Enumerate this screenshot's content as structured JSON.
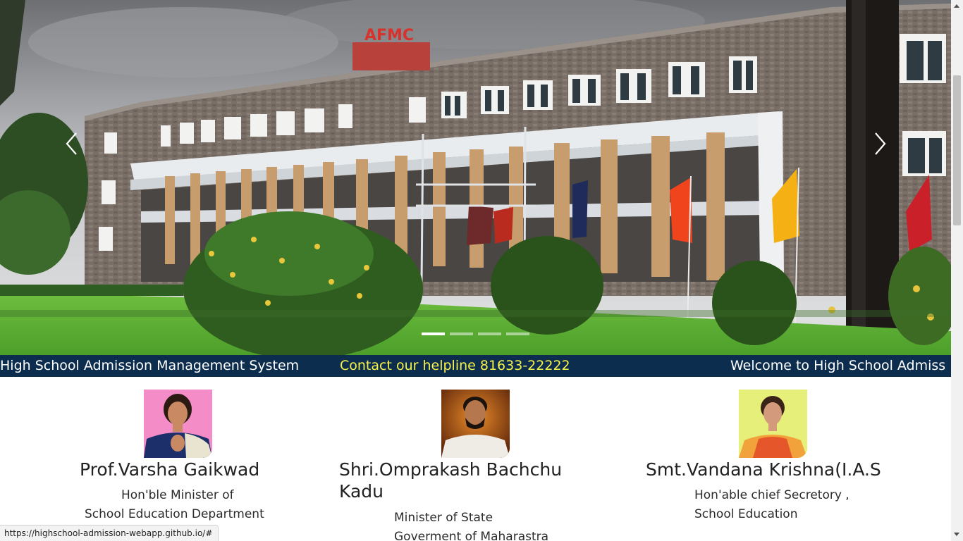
{
  "carousel": {
    "prev_label": "‹",
    "next_label": "›",
    "building_sign": "AFMC",
    "slides_count_label": "",
    "indicators": [
      {
        "active": true
      },
      {
        "active": false
      },
      {
        "active": false
      },
      {
        "active": false
      }
    ]
  },
  "marquee": {
    "items": [
      "High School Admission Management System",
      "Contact our helpline 81633-22222",
      "Welcome to High School Admiss"
    ],
    "highlight_color": "#f7f24a",
    "background_color": "#0d2d4e"
  },
  "officials": [
    {
      "name": "Prof.Varsha Gaikwad",
      "lines": [
        "Hon'ble Minister of",
        "School Education Department"
      ],
      "photo_background": "#f48cc8"
    },
    {
      "name_line1": "Shri.Omprakash Bachchu",
      "name_line2": "Kadu",
      "lines": [
        "Minister of State",
        "Goverment of Maharastra"
      ],
      "photo_background": "#c8601a"
    },
    {
      "name": "Smt.Vandana Krishna(I.A.S",
      "lines": [
        "Hon'able chief Secretory ,",
        "School Education"
      ],
      "photo_background": "#e6ef7a"
    }
  ],
  "statusbar": {
    "url": "https://highschool-admission-webapp.github.io/#"
  }
}
